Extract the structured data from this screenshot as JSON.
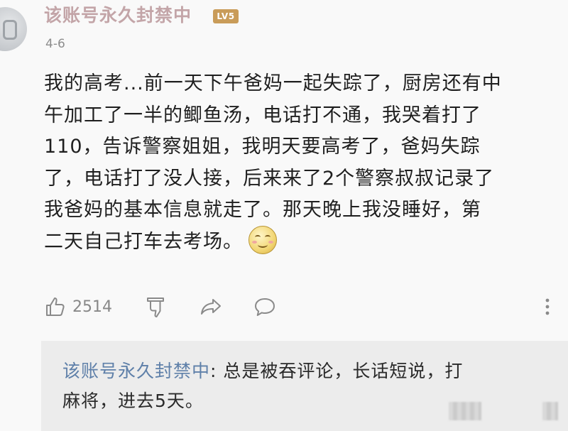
{
  "comment": {
    "username": "该账号永久封禁中",
    "level_badge": "LV5",
    "date": "4-6",
    "lines": [
      "我的高考...前一天下午爸妈一起失踪了，厨房还有中",
      "午加工了一半的鲫鱼汤，电话打不通，我哭着打了",
      "110，告诉警察姐姐，我明天要高考了，爸妈失踪",
      "了，电话打了没人接，后来来了2个警察叔叔记录了",
      "我爸妈的基本信息就走了。那天晚上我没睡好，第",
      "二天自己打车去考场。"
    ],
    "emoji": "smiling-face-emoji"
  },
  "actions": {
    "like_icon": "thumbs-up-icon",
    "like_count": "2514",
    "dislike_icon": "thumbs-down-icon",
    "share_icon": "share-arrow-icon",
    "comment_icon": "speech-bubble-icon",
    "more_icon": "vertical-dots-icon"
  },
  "reply": {
    "username": "该账号永久封禁中",
    "separator": ":",
    "text_line1": " 总是被吞评论，长话短说，打",
    "text_line2": "麻将，进去5天。"
  },
  "colors": {
    "username": "#c3a5a8",
    "reply_username": "#5f80a9",
    "badge": "#c99c59",
    "reply_bg": "#ececec"
  }
}
